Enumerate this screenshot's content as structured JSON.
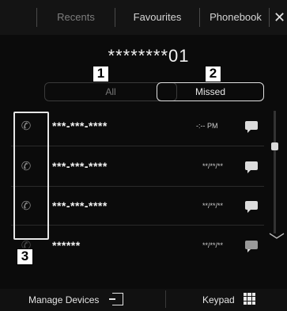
{
  "tabs": {
    "recents": "Recents",
    "favourites": "Favourites",
    "phonebook": "Phonebook"
  },
  "header": {
    "number": "********01"
  },
  "filters": {
    "all": "All",
    "missed": "Missed"
  },
  "calls": [
    {
      "number": "***-***-****",
      "time": "-:-- PM"
    },
    {
      "number": "***-***-****",
      "time": "**/**/**"
    },
    {
      "number": "***-***-****",
      "time": "**/**/**"
    },
    {
      "number": "******",
      "time": "**/**/**"
    }
  ],
  "callouts": {
    "one": "1",
    "two": "2",
    "three": "3"
  },
  "bottom": {
    "manage_devices": "Manage Devices",
    "keypad": "Keypad"
  },
  "icons": {
    "close": "close-icon",
    "phone": "phone-icon",
    "message": "message-icon",
    "devices": "devices-icon",
    "keypad": "keypad-grid-icon",
    "chevron": "chevron-down-icon"
  },
  "colors": {
    "background": "#0b0b0b",
    "text": "#e8e8e8",
    "dim_text": "#7d7d7d"
  }
}
